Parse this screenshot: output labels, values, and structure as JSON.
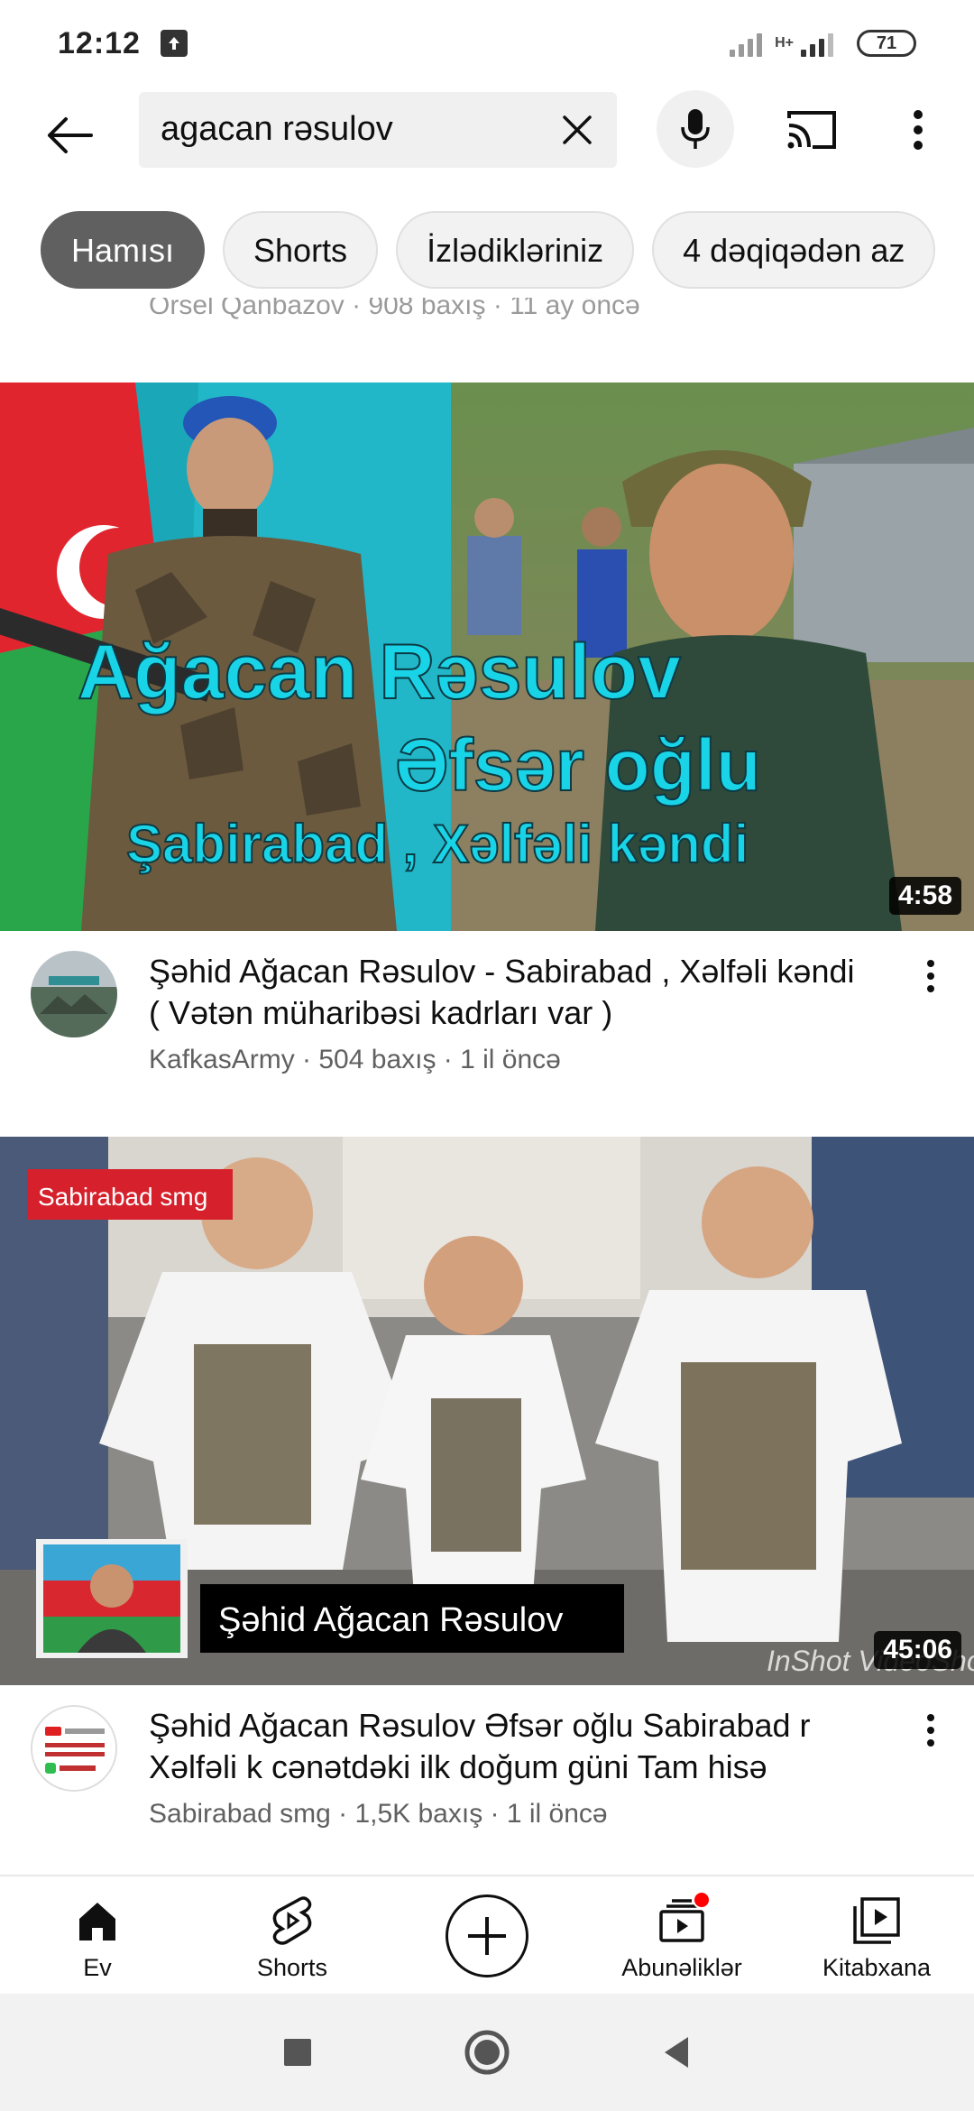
{
  "status_bar": {
    "time": "12:12",
    "network_label": "H+",
    "battery": "71"
  },
  "search": {
    "query": "agacan rəsulov"
  },
  "chips": [
    {
      "label": "Hamısı",
      "active": true
    },
    {
      "label": "Shorts",
      "active": false
    },
    {
      "label": "İzlədikləriniz",
      "active": false
    },
    {
      "label": "4 dəqiqədən az",
      "active": false
    }
  ],
  "previous_item": {
    "meta": "Orsel Qanbazov · 908 baxış · 11 ay öncə"
  },
  "videos": [
    {
      "duration": "4:58",
      "thumb_line1": "Ağacan Rəsulov",
      "thumb_line2": "Əfsər oğlu",
      "thumb_line3": "Şabirabad , Xəlfəli kəndi",
      "title": "Şəhid Ağacan Rəsulov - Sabirabad , Xəlfəli kəndi ( Vətən müharibəsi kadrları var )",
      "channel": "KafkasArmy",
      "views": "504 baxış",
      "age": "1 il öncə",
      "meta": "KafkasArmy · 504 baxış · 1 il öncə"
    },
    {
      "duration": "45:06",
      "thumb_tag": "Sabirabad smg",
      "thumb_caption": "Şəhid Ağacan Rəsulov",
      "thumb_watermark": "InShot VideoShow",
      "title": "Şəhid Ağacan Rəsulov Əfsər oğlu Sabirabad r Xəlfəli k cənətdəki ilk doğum güni Tam hisə",
      "channel": "Sabirabad smg",
      "views": "1,5K baxış",
      "age": "1 il öncə",
      "meta": "Sabirabad smg · 1,5K baxış · 1 il öncə"
    }
  ],
  "bottom_nav": {
    "home": "Ev",
    "shorts": "Shorts",
    "subscriptions": "Abunəliklər",
    "library": "Kitabxana"
  },
  "colors": {
    "accent_red": "#ff0000",
    "chip_active": "#606060",
    "thumb_text_cyan": "#19d3e6"
  }
}
